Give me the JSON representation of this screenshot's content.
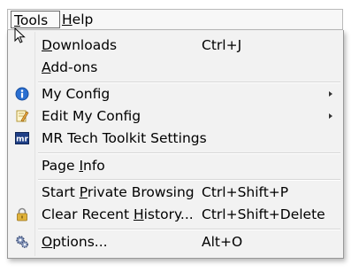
{
  "menubar": {
    "tools": {
      "prefix": "T",
      "rest": "ools"
    },
    "help": {
      "prefix": "H",
      "rest": "elp"
    }
  },
  "tools_menu": {
    "downloads": {
      "prefix": "D",
      "rest": "ownloads",
      "shortcut": "Ctrl+J"
    },
    "addons": {
      "prefix": "A",
      "rest": "dd-ons"
    },
    "my_config": {
      "label": "My Config",
      "icon": "info-icon"
    },
    "edit_my_config": {
      "label": "Edit My Config",
      "icon": "edit-icon"
    },
    "mr_tech": {
      "label": "MR Tech Toolkit Settings",
      "icon_text": "mr"
    },
    "page_info": {
      "before": "Page ",
      "accel": "I",
      "after": "nfo"
    },
    "private_browsing": {
      "before": "Start ",
      "accel": "P",
      "after": "rivate Browsing",
      "shortcut": "Ctrl+Shift+P"
    },
    "clear_history": {
      "before": "Clear Recent ",
      "accel": "H",
      "after": "istory...",
      "shortcut": "Ctrl+Shift+Delete",
      "icon": "lock-icon"
    },
    "options": {
      "accel": "O",
      "after": "ptions...",
      "shortcut": "Alt+O",
      "icon": "gears-icon"
    }
  }
}
